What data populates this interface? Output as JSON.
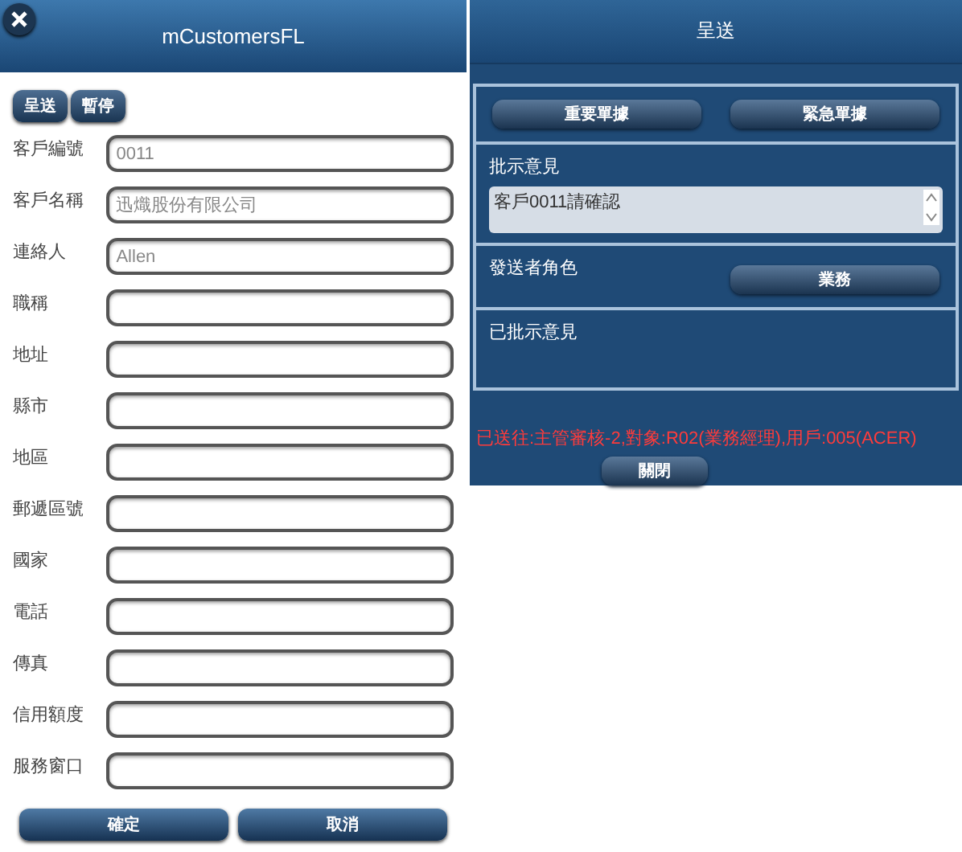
{
  "form": {
    "title": "mCustomersFL",
    "toolbar": [
      "呈送",
      "暫停"
    ],
    "fields": [
      {
        "label": "客戶編號",
        "value": "0011"
      },
      {
        "label": "客戶名稱",
        "value": "迅熾股份有限公司"
      },
      {
        "label": "連絡人",
        "value": "Allen"
      },
      {
        "label": "職稱"
      },
      {
        "label": "地址"
      },
      {
        "label": "縣市"
      },
      {
        "label": "地區"
      },
      {
        "label": "郵遞區號"
      },
      {
        "label": "國家"
      },
      {
        "label": "電話"
      },
      {
        "label": "傳真"
      },
      {
        "label": "信用額度"
      },
      {
        "label": "服務窗口"
      }
    ],
    "buttons": [
      "確定",
      "取消"
    ]
  },
  "dialog": {
    "title": "呈送",
    "flag_buttons": [
      "重要單據",
      "緊急單據"
    ],
    "comment_label": "批示意見",
    "comment": "客戶0011請確認",
    "role_label": "發送者角色",
    "role": "業務",
    "history_label": "已批示意見",
    "message": "已送往:主管審核-2,對象:R02(業務經理),用戶:005(ACER)",
    "close": "關閉"
  }
}
